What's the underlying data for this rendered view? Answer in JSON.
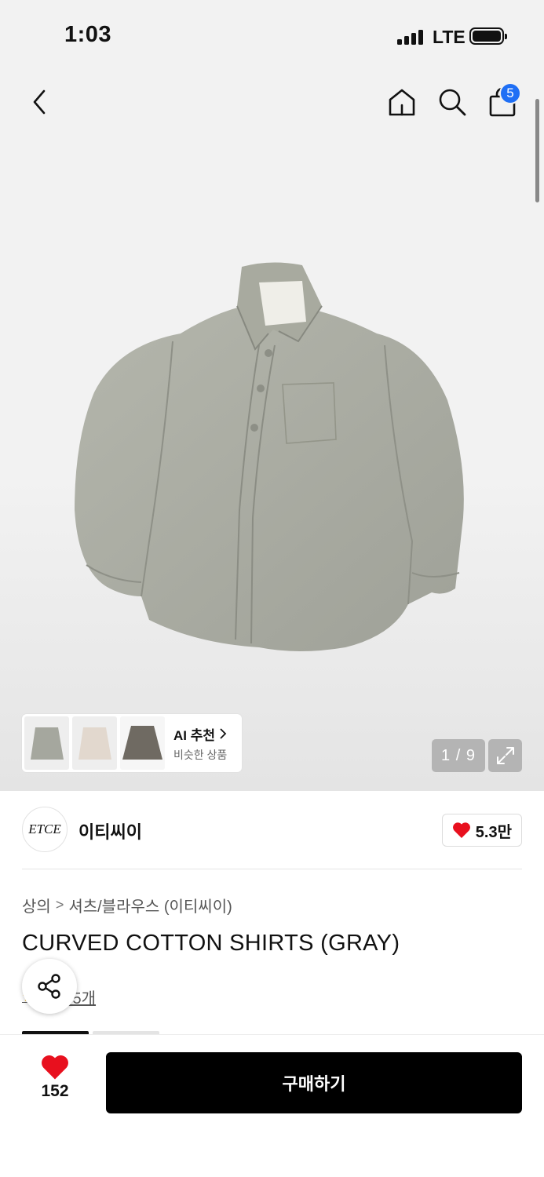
{
  "status_bar": {
    "time": "1:03",
    "network": "LTE"
  },
  "header": {
    "back_icon": "chevron-left-icon",
    "home_icon": "home-icon",
    "search_icon": "search-icon",
    "cart_icon": "shopping-bag-icon",
    "cart_count": "5"
  },
  "gallery": {
    "page_counter": "1 / 9",
    "expand_icon": "expand-icon",
    "ai_recommend": {
      "title": "AI 추천",
      "subtitle": "비슷한 상품"
    }
  },
  "brand": {
    "logo_text": "ETCE",
    "name": "이티씨이",
    "likes": "5.3만"
  },
  "product": {
    "breadcrumb": [
      "상의",
      "셔츠/블라우스 (이티씨이)"
    ],
    "title": "CURVED COTTON SHIRTS (GRAY)",
    "review_link": "후기 5개"
  },
  "bottom_bar": {
    "likes": "152",
    "buy_label": "구매하기"
  },
  "colors": {
    "accent_blue": "#1f6ff5",
    "heart_red": "#e8101e",
    "buy_button": "#000000"
  }
}
